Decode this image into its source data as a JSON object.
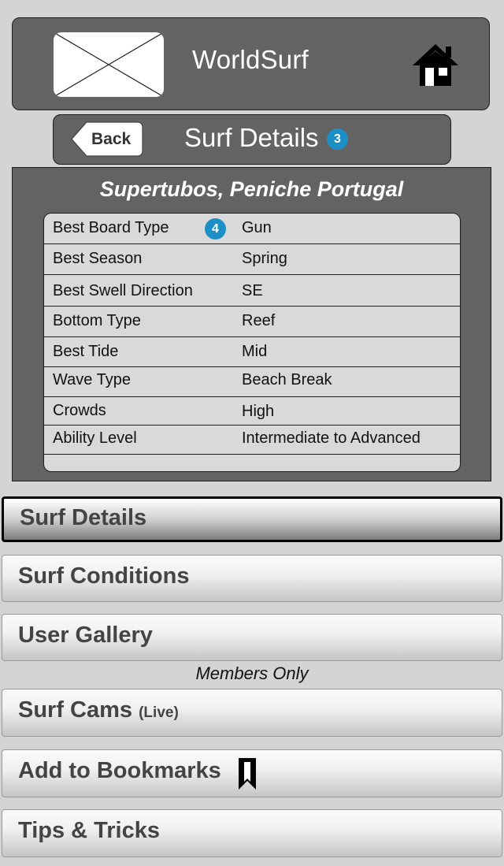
{
  "app": {
    "title": "WorldSurf",
    "logo_icon": "image-placeholder-icon",
    "home_icon": "home-icon"
  },
  "subheader": {
    "back_label": "Back",
    "title": "Surf Details",
    "badge": "3"
  },
  "spot": {
    "name": "Supertubos, Peniche Portugal",
    "badge": "4",
    "details": [
      {
        "label": "Best Board Type",
        "value": "Gun"
      },
      {
        "label": "Best Season",
        "value": "Spring"
      },
      {
        "label": "Best Swell Direction",
        "value": "SE"
      },
      {
        "label": "Bottom Type",
        "value": "Reef"
      },
      {
        "label": "Best Tide",
        "value": "Mid"
      },
      {
        "label": "Wave Type",
        "value": "Beach Break"
      },
      {
        "label": "Crowds",
        "value": "High"
      },
      {
        "label": "Ability Level",
        "value": "Intermediate to Advanced"
      }
    ]
  },
  "nav": {
    "surf_details": "Surf Details",
    "surf_conditions": "Surf Conditions",
    "user_gallery": "User Gallery",
    "members_only": "Members Only",
    "surf_cams": "Surf Cams",
    "surf_cams_sub": "(Live)",
    "add_bookmarks": "Add to Bookmarks",
    "bookmark_icon": "bookmark-icon",
    "tips_tricks": "Tips & Tricks"
  },
  "colors": {
    "panel": "#636363",
    "background": "#d4d4d4",
    "badge": "#1b8fc6"
  }
}
